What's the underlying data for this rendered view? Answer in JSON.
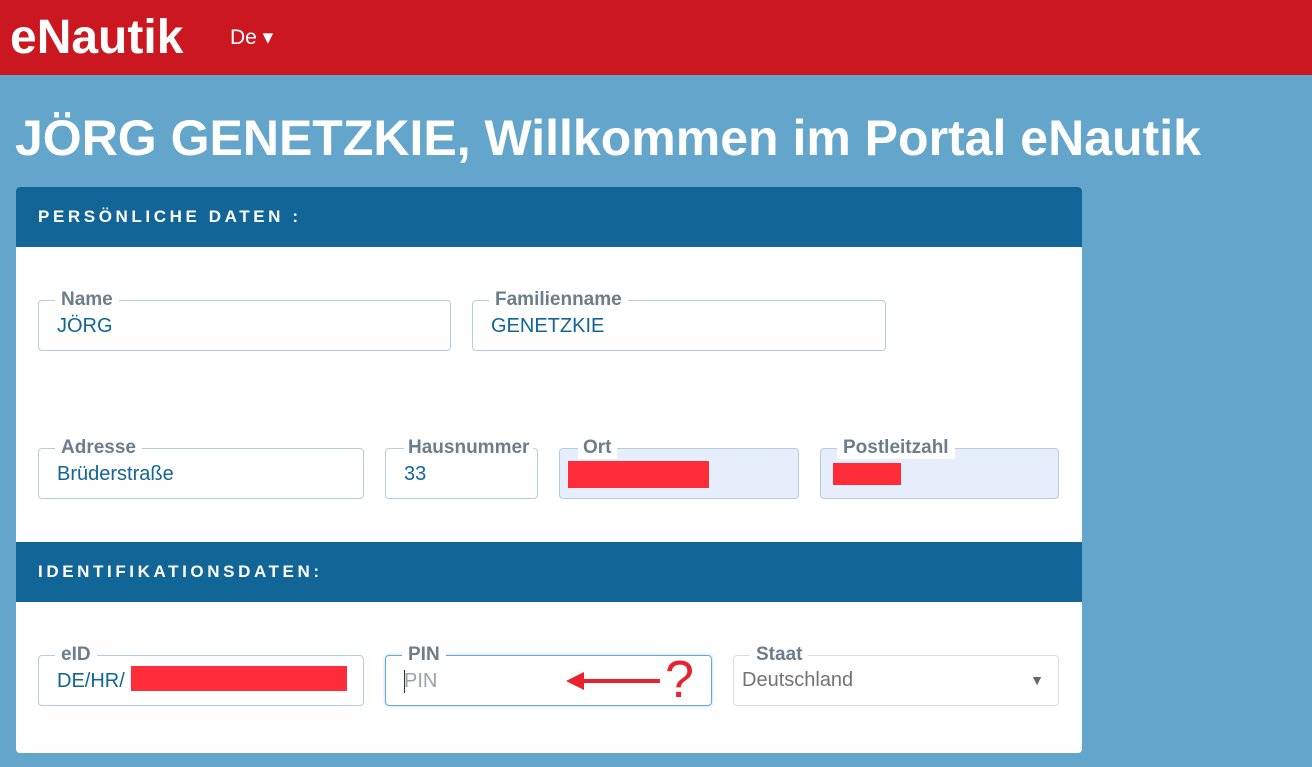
{
  "header": {
    "brand": "eNautik",
    "language": "De ▾"
  },
  "welcome": "JÖRG GENETZKIE, Willkommen im Portal eNautik",
  "sections": {
    "personal": {
      "title": "PERSÖNLICHE DATEN :",
      "name": {
        "label": "Name",
        "value": "JÖRG"
      },
      "surname": {
        "label": "Familienname",
        "value": "GENETZKIE"
      },
      "address": {
        "label": "Adresse",
        "value": "Brüderstraße"
      },
      "house_number": {
        "label": "Hausnummer",
        "value": "33"
      },
      "city": {
        "label": "Ort"
      },
      "postal_code": {
        "label": "Postleitzahl"
      }
    },
    "identification": {
      "title": "IDENTIFIKATIONSDATEN:",
      "eid": {
        "label": "eID",
        "value": "DE/HR/"
      },
      "pin": {
        "label": "PIN",
        "placeholder": "PIN"
      },
      "country": {
        "label": "Staat",
        "value": "Deutschland"
      }
    }
  },
  "annotation": {
    "symbol": "?",
    "color": "#e8222e"
  },
  "colors": {
    "header_red": "#cb1720",
    "background_blue": "#64a6cb",
    "section_header": "#126597",
    "redaction": "#ff2d3a"
  }
}
